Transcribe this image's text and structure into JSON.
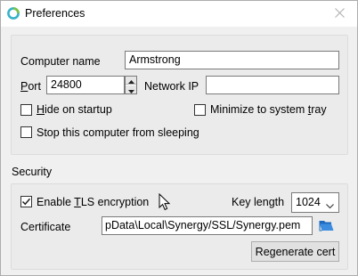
{
  "window": {
    "title": "Preferences"
  },
  "general": {
    "computer_name_label": "Computer name",
    "computer_name_value": "Armstrong",
    "port_label_first": "P",
    "port_label_rest": "ort",
    "port_value": "24800",
    "network_ip_label": "Network IP",
    "network_ip_value": "",
    "hide_on_startup_first": "H",
    "hide_on_startup_rest": "ide on startup",
    "hide_on_startup_checked": false,
    "minimize_to_tray_before": "Minimize to system ",
    "minimize_to_tray_first": "t",
    "minimize_to_tray_rest": "ray",
    "minimize_to_tray_checked": false,
    "stop_sleeping_label": "Stop this computer from sleeping",
    "stop_sleeping_checked": false
  },
  "security": {
    "heading": "Security",
    "tls_before": "Enable ",
    "tls_first": "T",
    "tls_rest": "LS encryption",
    "tls_checked": true,
    "key_length_label": "Key length",
    "key_length_value": "1024",
    "certificate_label": "Certificate",
    "certificate_value": "pData\\Local\\Synergy/SSL/Synergy.pem",
    "regenerate_label": "Regenerate cert"
  },
  "icons": {
    "app": "synergy-ring-icon",
    "close": "close-icon",
    "folder": "open-folder-icon",
    "cursor": "mouse-cursor-icon"
  }
}
